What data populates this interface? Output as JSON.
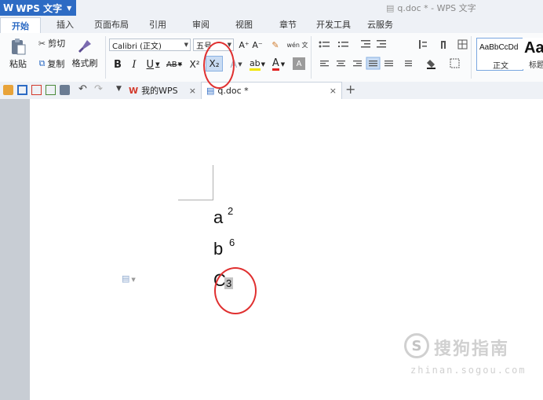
{
  "app": {
    "menu_label": "WPS 文字",
    "window_title": "q.doc * - WPS 文字"
  },
  "ribbon_tabs": [
    {
      "label": "开始",
      "active": true
    },
    {
      "label": "插入"
    },
    {
      "label": "页面布局"
    },
    {
      "label": "引用"
    },
    {
      "label": "审阅"
    },
    {
      "label": "视图"
    },
    {
      "label": "章节"
    },
    {
      "label": "开发工具"
    },
    {
      "label": "云服务"
    }
  ],
  "clipboard": {
    "paste_label": "粘贴",
    "cut_label": "剪切",
    "copy_label": "复制",
    "format_painter_label": "格式刷"
  },
  "font": {
    "family_value": "Calibri (正文)",
    "size_value": "五号",
    "grow_label": "A⁺",
    "shrink_label": "A⁻",
    "bold": "B",
    "italic": "I",
    "underline": "U",
    "strikethrough": "AB",
    "superscript": "X²",
    "subscript": "X₂",
    "font_color": "A",
    "char_shading": "A",
    "phonetic": "wén 文"
  },
  "styles": {
    "normal_preview": "AaBbCcDd",
    "normal_label": "正文",
    "h1_preview": "Aa",
    "h1_label": "标题"
  },
  "doc_tabs": [
    {
      "label": "我的WPS",
      "close": "×"
    },
    {
      "label": "q.doc *",
      "close": "×",
      "active": true
    }
  ],
  "new_tab_label": "+",
  "document": {
    "lines": [
      {
        "base": "a",
        "script": "2",
        "type": "superscript"
      },
      {
        "base": "b",
        "script": "6",
        "type": "superscript"
      },
      {
        "base": "C",
        "script": "3",
        "type": "subscript"
      }
    ]
  },
  "watermark": {
    "logo": "S",
    "text": "搜狗指南",
    "url": "zhinan.sogou.com"
  },
  "colors": {
    "accent": "#2d6bc4",
    "annotation_circle": "#e03030",
    "wps_red": "#d33a2c"
  }
}
